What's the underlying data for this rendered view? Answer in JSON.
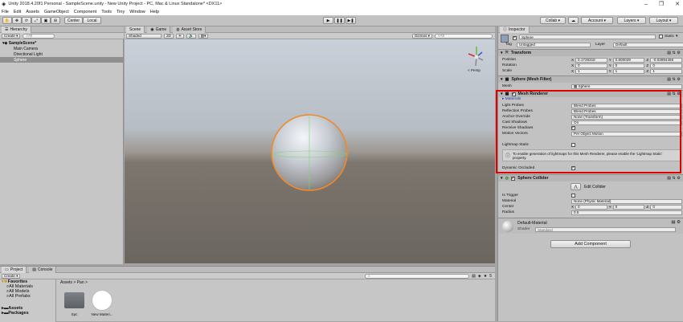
{
  "window": {
    "title": "Unity 2018.4.20f1 Personal - SampleScene.unity - New Unity Project - PC, Mac & Linux Standalone* <DX11>"
  },
  "menu": [
    "File",
    "Edit",
    "Assets",
    "GameObject",
    "Component",
    "Tools",
    "Tiny",
    "Window",
    "Help"
  ],
  "toolbar": {
    "center_label": "Center",
    "local_label": "Local",
    "collab_label": "Collab",
    "account_label": "Account",
    "layers_label": "Layers",
    "layout_label": "Layout"
  },
  "hierarchy": {
    "tab": "Hierarchy",
    "create": "Create",
    "search": "All",
    "scene": "SampleScene*",
    "items": [
      "Main Camera",
      "Directional Light",
      "Sphere"
    ]
  },
  "scene": {
    "tabs": [
      "Scene",
      "Game",
      "Asset Store"
    ],
    "shading": "Shaded",
    "mode_2d": "2D",
    "gizmos": "Gizmos",
    "search": "All",
    "persp": "< Persp"
  },
  "project": {
    "tabs": [
      "Project",
      "Console"
    ],
    "create": "Create",
    "tree": [
      "Favorites",
      "All Materials",
      "All Models",
      "All Prefabs",
      "Assets",
      "Packages"
    ],
    "breadcrumb": "Assets > Pan >",
    "items": [
      "Spc",
      "New Materi..."
    ],
    "count": "5"
  },
  "inspector": {
    "tab": "Inspector",
    "name": "Sphere",
    "static_label": "Static",
    "tag_label": "Tag",
    "tag_value": "Untagged",
    "layer_label": "Layer",
    "layer_value": "Default",
    "transform": {
      "title": "Transform",
      "rows": [
        {
          "label": "Position",
          "x": "0.1729318",
          "y": "0.600029",
          "z": "-0.03894466"
        },
        {
          "label": "Rotation",
          "x": "0",
          "y": "0",
          "z": "0"
        },
        {
          "label": "Scale",
          "x": "1",
          "y": "1",
          "z": "1"
        }
      ]
    },
    "mesh_filter": {
      "title": "Sphere (Mesh Filter)",
      "mesh_label": "Mesh",
      "mesh_value": "Sphere"
    },
    "mesh_renderer": {
      "title": "Mesh Renderer",
      "materials": "Materials",
      "rows": [
        {
          "label": "Light Probes",
          "value": "Blend Probes"
        },
        {
          "label": "Reflection Probes",
          "value": "Blend Probes"
        },
        {
          "label": "Anchor Override",
          "value": "None (Transform)"
        },
        {
          "label": "Cast Shadows",
          "value": "On"
        },
        {
          "label": "Receive Shadows",
          "value": "✓"
        },
        {
          "label": "Motion Vectors",
          "value": "Per Object Motion"
        }
      ],
      "lightmap_static": "Lightmap Static",
      "info": "To enable generation of lightmaps for this Mesh Renderer, please enable the 'Lightmap Static' property.",
      "dynamic_occluded": "Dynamic Occluded"
    },
    "collider": {
      "title": "Sphere Collider",
      "edit": "Edit Collider",
      "rows": [
        {
          "label": "Is Trigger",
          "value": ""
        },
        {
          "label": "Material",
          "value": "None (Physic Material)"
        },
        {
          "label": "Center",
          "x": "0",
          "y": "0",
          "z": "0"
        },
        {
          "label": "Radius",
          "value": "0.5"
        }
      ]
    },
    "material": {
      "name": "Default-Material",
      "shader_label": "Shader",
      "shader_value": "Standard"
    },
    "add_component": "Add Component"
  },
  "colors": {
    "highlight": "#e00000",
    "selection": "#8f8f8f"
  }
}
